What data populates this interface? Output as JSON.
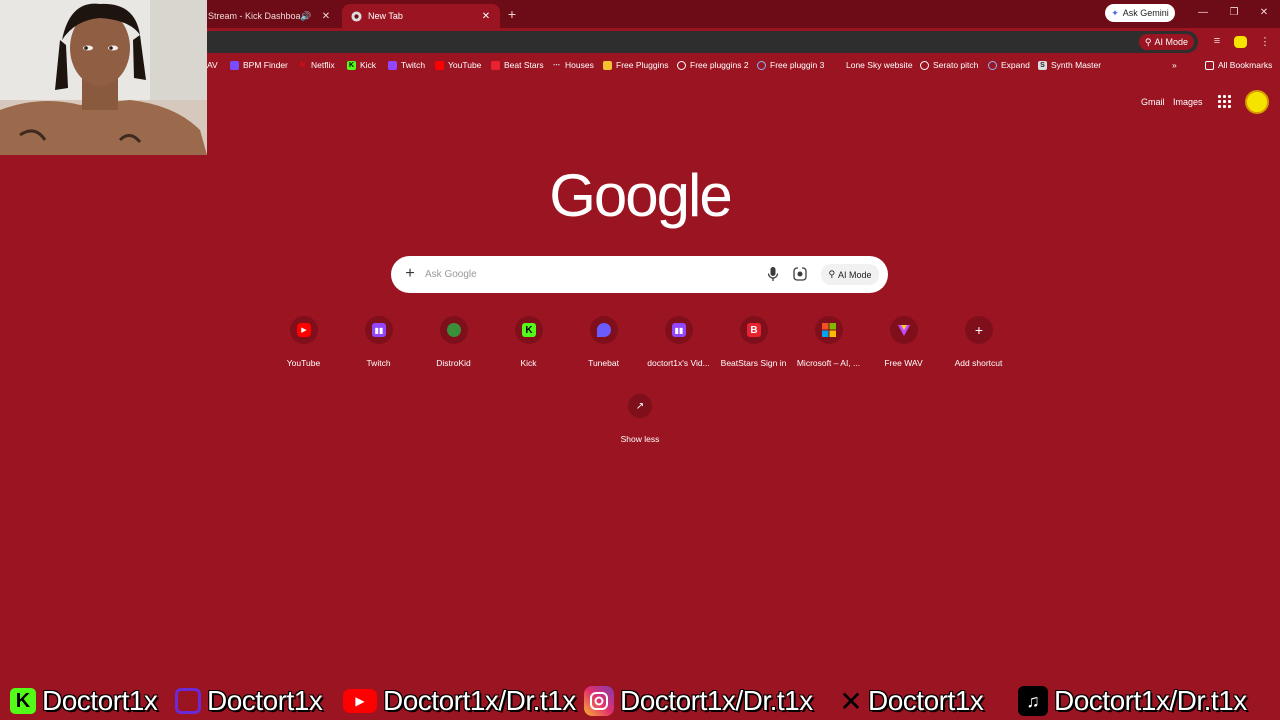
{
  "tabs": [
    {
      "title": "Stream - Kick Dashboard"
    },
    {
      "title": "New Tab"
    }
  ],
  "browser": {
    "ask_gemini": "Ask Gemini",
    "ai_mode": "AI Mode"
  },
  "bookmarks": {
    "items": [
      {
        "label": "AV"
      },
      {
        "label": "BPM Finder"
      },
      {
        "label": "Netflix"
      },
      {
        "label": "Kick"
      },
      {
        "label": "Twitch"
      },
      {
        "label": "YouTube"
      },
      {
        "label": "Beat Stars"
      },
      {
        "label": "Houses"
      },
      {
        "label": "Free Pluggins"
      },
      {
        "label": "Free pluggins 2"
      },
      {
        "label": "Free pluggin 3"
      },
      {
        "label": "Lone Sky website"
      },
      {
        "label": "Serato pitch"
      },
      {
        "label": "Expand"
      },
      {
        "label": "Synth Master"
      }
    ],
    "all_bookmarks": "All Bookmarks"
  },
  "header": {
    "gmail": "Gmail",
    "images": "Images"
  },
  "logo": "Google",
  "search": {
    "placeholder": "Ask Google",
    "ai_mode": "AI Mode"
  },
  "shortcuts": [
    {
      "label": "YouTube",
      "color": "#ff0000"
    },
    {
      "label": "Twitch",
      "color": "#9146ff"
    },
    {
      "label": "DistroKid",
      "color": "#3a8f3a"
    },
    {
      "label": "Kick",
      "color": "#53fc18"
    },
    {
      "label": "Tunebat",
      "color": "#6b5cff"
    },
    {
      "label": "doctort1x's Vid...",
      "color": "#9146ff"
    },
    {
      "label": "BeatStars Sign in",
      "color": "#e8222f"
    },
    {
      "label": "Microsoft – AI, ...",
      "color": "#f25022"
    },
    {
      "label": "Free WAV",
      "color": "#c04cff"
    },
    {
      "label": "Add shortcut",
      "color": "#ffffff"
    }
  ],
  "show_less": "Show less",
  "social": [
    {
      "platform": "kick-icon",
      "handle": "Doctort1x"
    },
    {
      "platform": "twitch-icon",
      "handle": "Doctort1x"
    },
    {
      "platform": "youtube-icon",
      "handle": "Doctort1x/Dr.t1x"
    },
    {
      "platform": "instagram-icon",
      "handle": "Doctort1x/Dr.t1x"
    },
    {
      "platform": "x-icon",
      "handle": "Doctort1x"
    },
    {
      "platform": "tiktok-icon",
      "handle": "Doctort1x/Dr.t1x"
    }
  ]
}
